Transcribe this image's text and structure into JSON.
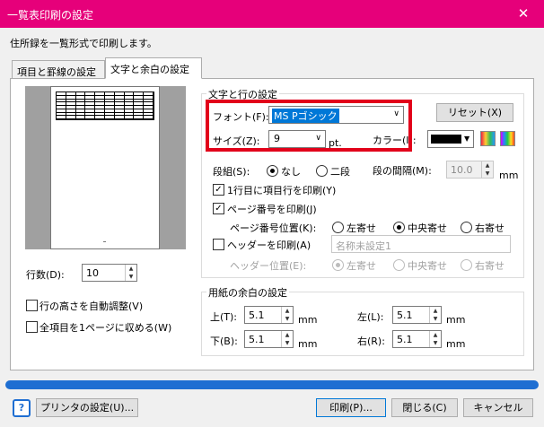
{
  "window": {
    "title": "一覧表印刷の設定",
    "close_glyph": "✕"
  },
  "description": "住所録を一覧形式で印刷します。",
  "tabs": [
    {
      "label": "項目と罫線の設定"
    },
    {
      "label": "文字と余白の設定"
    }
  ],
  "left": {
    "rows_label": "行数(D):",
    "rows_value": "10",
    "auto_height_label": "行の高さを自動調整(V)",
    "fit_page_label": "全項目を1ページに収める(W)"
  },
  "text_group": {
    "title": "文字と行の設定",
    "font_label": "フォント(F):",
    "font_value": "MS Pゴシック",
    "reset_label": "リセット(X)",
    "size_label": "サイズ(Z):",
    "size_value": "9",
    "size_unit": "pt.",
    "color_label": "カラー(I):",
    "color_value": "#000000",
    "columns_label": "段組(S):",
    "columns_options": [
      "なし",
      "二段"
    ],
    "columns_selected": 0,
    "gap_label": "段の間隔(M):",
    "gap_value": "10.0",
    "gap_unit": "mm",
    "header_row_label": "1行目に項目行を印刷(Y)",
    "header_row_checked": true,
    "page_number_label": "ページ番号を印刷(J)",
    "page_number_checked": true,
    "page_number_pos_label": "ページ番号位置(K):",
    "pos_options": [
      "左寄せ",
      "中央寄せ",
      "右寄せ"
    ],
    "page_number_pos_selected": 1,
    "header_label": "ヘッダーを印刷(A)",
    "header_checked": false,
    "header_text_placeholder": "名称未設定1",
    "header_pos_label": "ヘッダー位置(E):",
    "header_pos_selected": 0
  },
  "margin_group": {
    "title": "用紙の余白の設定",
    "top_label": "上(T):",
    "top_value": "5.1",
    "bottom_label": "下(B):",
    "bottom_value": "5.1",
    "left_label": "左(L):",
    "left_value": "5.1",
    "right_label": "右(R):",
    "right_value": "5.1",
    "unit": "mm"
  },
  "footer": {
    "help_glyph": "?",
    "printer_settings_label": "プリンタの設定(U)...",
    "print_label": "印刷(P)...",
    "close_label": "閉じる(C)",
    "cancel_label": "キャンセル"
  },
  "colors": {
    "titlebar": "#e6007a",
    "highlight": "#e2001a",
    "progress": "#1e6ed2",
    "selection": "#0078d7"
  }
}
